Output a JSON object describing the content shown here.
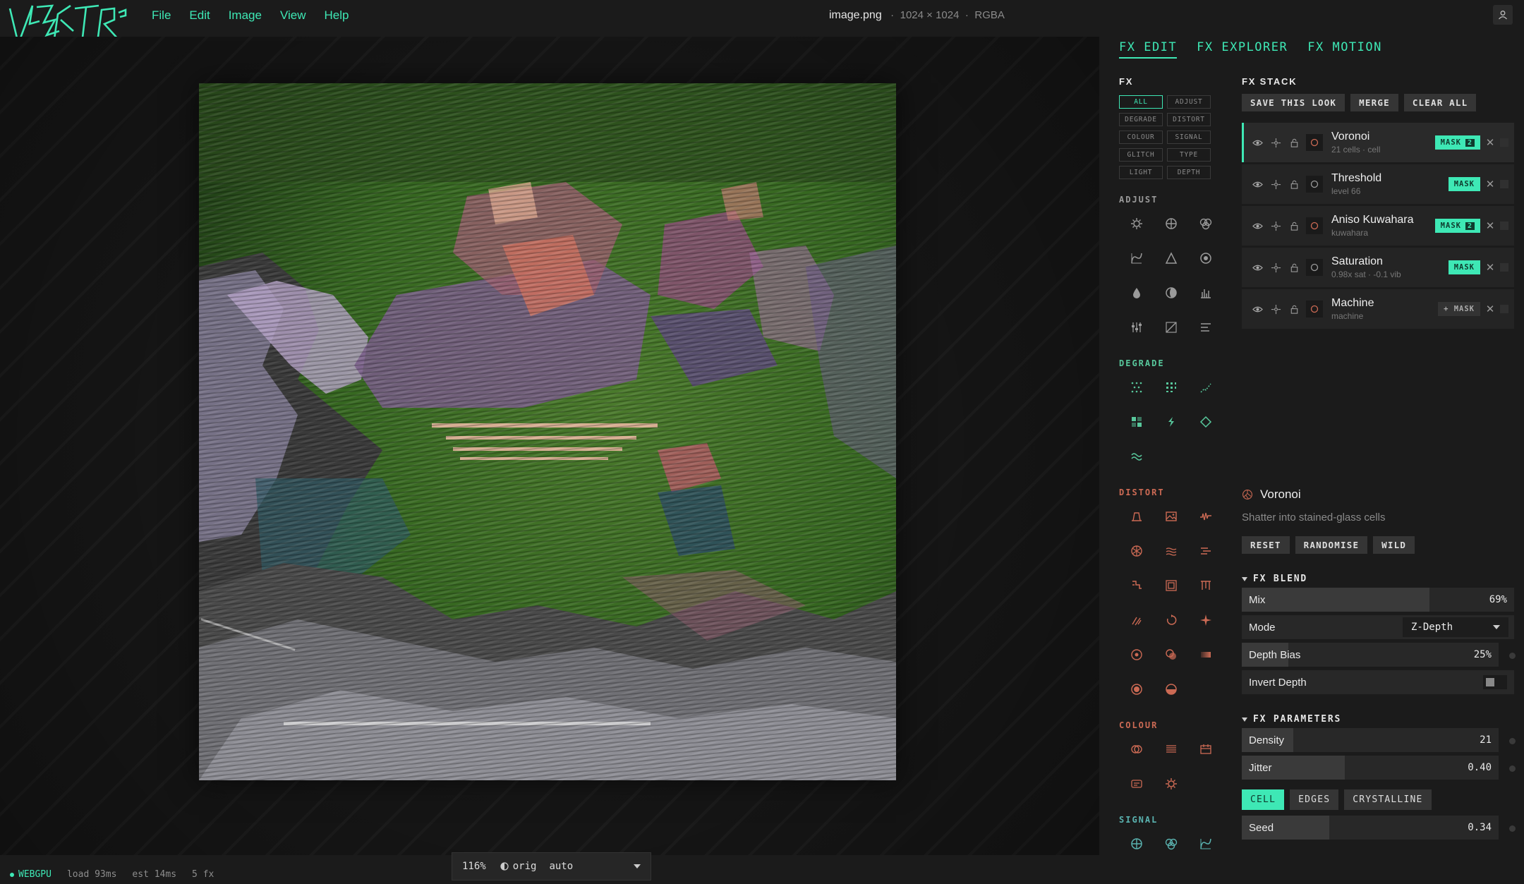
{
  "app": {
    "logo_text": "VEKTOR"
  },
  "menu": [
    "File",
    "Edit",
    "Image",
    "View",
    "Help"
  ],
  "file": {
    "name": "image.png",
    "dims": "1024 × 1024",
    "sep": "·",
    "mode": "RGBA"
  },
  "tabs": [
    "FX EDIT",
    "FX EXPLORER",
    "FX MOTION"
  ],
  "fx": {
    "title": "FX",
    "filters": [
      "ALL",
      "ADJUST",
      "DEGRADE",
      "DISTORT",
      "COLOUR",
      "SIGNAL",
      "GLITCH",
      "TYPE",
      "LIGHT",
      "DEPTH"
    ],
    "categories": [
      {
        "name": "ADJUST",
        "color": "#9a9a9a",
        "count": 12
      },
      {
        "name": "DEGRADE",
        "color": "#58c89c",
        "count": 7
      },
      {
        "name": "DISTORT",
        "color": "#cc6a54",
        "count": 17
      },
      {
        "name": "COLOUR",
        "color": "#cc6a54",
        "count": 5
      },
      {
        "name": "SIGNAL",
        "color": "#5ab3b0",
        "count": 3
      }
    ]
  },
  "stack": {
    "title": "FX STACK",
    "buttons": [
      "SAVE THIS LOOK",
      "MERGE",
      "CLEAR ALL"
    ],
    "items": [
      {
        "name": "Voronoi",
        "sub": "21 cells · cell",
        "mask": "MASK",
        "mask_count": "2",
        "selected": true
      },
      {
        "name": "Threshold",
        "sub": "level 66",
        "mask": "MASK",
        "mask_count": ""
      },
      {
        "name": "Aniso Kuwahara",
        "sub": "kuwahara",
        "mask": "MASK",
        "mask_count": "2"
      },
      {
        "name": "Saturation",
        "sub": "0.98x sat · -0.1 vib",
        "mask": "MASK",
        "mask_count": ""
      },
      {
        "name": "Machine",
        "sub": "machine",
        "mask": "+ MASK",
        "mask_count": ""
      }
    ]
  },
  "detail": {
    "name": "Voronoi",
    "desc": "Shatter into stained-glass cells",
    "actions": [
      "RESET",
      "RANDOMISE",
      "WILD"
    ],
    "blend": {
      "title": "FX BLEND",
      "mix_label": "Mix",
      "mix_value": "69%",
      "mode_label": "Mode",
      "mode_value": "Z-Depth",
      "bias_label": "Depth Bias",
      "bias_value": "25%",
      "invert_label": "Invert Depth"
    },
    "params": {
      "title": "FX PARAMETERS",
      "density_label": "Density",
      "density_value": "21",
      "jitter_label": "Jitter",
      "jitter_value": "0.40",
      "modes": [
        "CELL",
        "EDGES",
        "CRYSTALLINE"
      ],
      "seed_label": "Seed",
      "seed_value": "0.34"
    }
  },
  "zoom": {
    "level": "116%",
    "orig": "orig",
    "mode": "auto"
  },
  "status": {
    "gpu": "WEBGPU",
    "load": "load 93ms",
    "est": "est 14ms",
    "fx": "5 fx"
  },
  "colors": {
    "accent": "#3ee8b5",
    "bg": "#1b1b1b",
    "panel": "#242424"
  }
}
